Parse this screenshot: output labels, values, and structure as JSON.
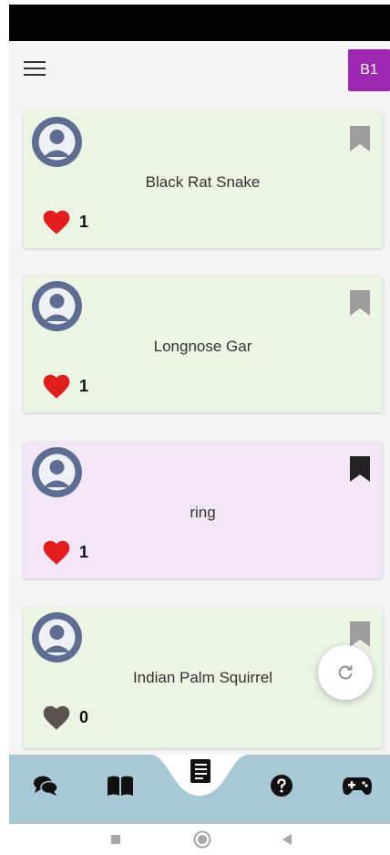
{
  "header": {
    "menu_icon": "hamburger-menu-icon",
    "user_badge": "B1",
    "user_badge_color": "#9c27b0"
  },
  "cards": [
    {
      "title": "Black Rat Snake",
      "likes": "1",
      "liked": true,
      "bookmarked": false,
      "background": "#ecf5e4"
    },
    {
      "title": "Longnose Gar",
      "likes": "1",
      "liked": true,
      "bookmarked": false,
      "background": "#ecf5e4"
    },
    {
      "title": "ring",
      "likes": "1",
      "liked": true,
      "bookmarked": true,
      "background": "#f2e6f7"
    },
    {
      "title": "Indian Palm Squirrel",
      "likes": "0",
      "liked": false,
      "bookmarked": false,
      "background": "#ecf5e4"
    }
  ],
  "fab": {
    "icon": "refresh-icon"
  },
  "bottom_nav": {
    "background": "#a9c8d6",
    "items": [
      "chat-icon",
      "book-icon",
      "notebook-icon",
      "help-icon",
      "gamepad-icon"
    ],
    "selected": "notebook-icon"
  },
  "system_nav": [
    "recent-apps-icon",
    "home-icon",
    "back-icon"
  ]
}
